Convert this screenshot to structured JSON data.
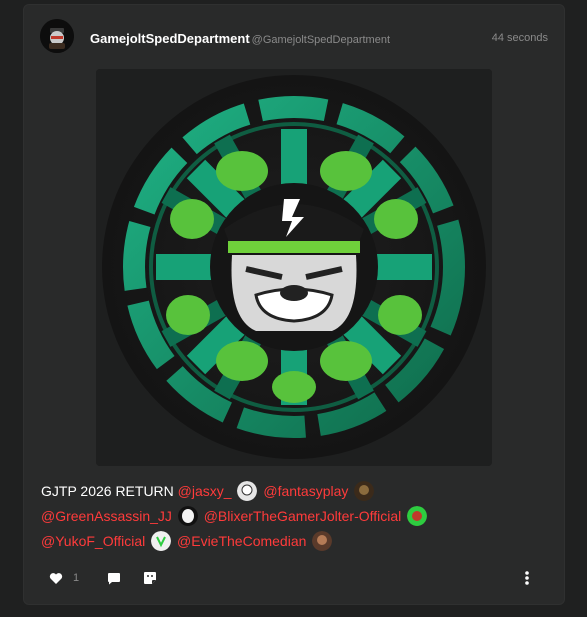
{
  "post": {
    "display_name": "GamejoltSpedDepartment",
    "username": "@GamejoltSpedDepartment",
    "timestamp": "44 seconds"
  },
  "caption": {
    "text": "GJTP 2026 RETURN ",
    "mentions": [
      "@jasxy_",
      "@fantasyplay",
      "@GreenAssassin_JJ",
      "@BlixerTheGamerJolter-Official",
      "@YukoF_Official",
      "@EvieTheComedian"
    ]
  },
  "actions": {
    "like_count": "1"
  },
  "icons": {
    "like": "heart-icon",
    "comment": "comment-icon",
    "repost": "sticker-icon",
    "more": "more-vertical-icon"
  },
  "colors": {
    "mention": "#ff3b3b",
    "logo_ring": "#1a9a6d",
    "logo_bg": "#141414"
  }
}
